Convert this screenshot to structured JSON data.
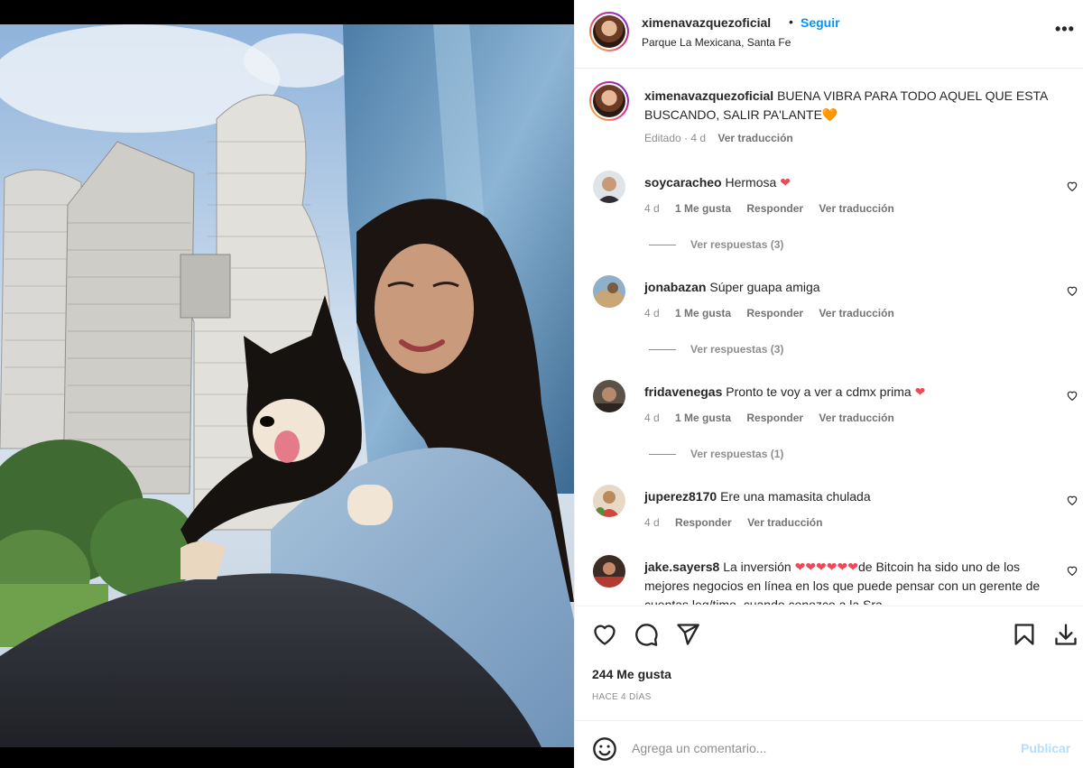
{
  "post": {
    "username": "ximenavazquezoficial",
    "separator": "•",
    "follow_label": "Seguir",
    "location": "Parque La Mexicana, Santa Fe",
    "more_label": "•••"
  },
  "caption": {
    "username": "ximenavazquezoficial",
    "text": "BUENA VIBRA PARA TODO AQUEL QUE ESTA BUSCANDO, SALIR PA'LANTE",
    "emoji": "🧡",
    "edited": "Editado · 4 d",
    "translate": "Ver traducción"
  },
  "comments": [
    {
      "username": "soycaracheo",
      "text": "Hermosa ",
      "emoji": "❤",
      "time": "4 d",
      "likes": "1 Me gusta",
      "reply": "Responder",
      "translate": "Ver traducción",
      "replies": "Ver respuestas (3)"
    },
    {
      "username": "jonabazan",
      "text": "Súper guapa amiga",
      "emoji": "",
      "time": "4 d",
      "likes": "1 Me gusta",
      "reply": "Responder",
      "translate": "Ver traducción",
      "replies": "Ver respuestas (3)"
    },
    {
      "username": "fridavenegas",
      "text": "Pronto te voy a ver a cdmx prima ",
      "emoji": "❤",
      "time": "4 d",
      "likes": "1 Me gusta",
      "reply": "Responder",
      "translate": "Ver traducción",
      "replies": "Ver respuestas (1)"
    },
    {
      "username": "juperez8170",
      "text": "Ere una mamasita chulada",
      "emoji": "",
      "time": "4 d",
      "reply": "Responder",
      "translate": "Ver traducción"
    },
    {
      "username": "jake.sayers8",
      "text_before": "La inversión ",
      "hearts": "❤❤❤❤❤❤",
      "text_after": "de Bitcoin ha sido uno de los mejores negocios en línea en los que puede pensar con un gerente de cuentas leg/timo, cuando conozco a la Sra."
    }
  ],
  "actions": {
    "like_icon": "heart-icon",
    "comment_icon": "comment-icon",
    "share_icon": "share-icon",
    "save_icon": "bookmark-icon",
    "download_icon": "download-icon"
  },
  "likes_text": "244 Me gusta",
  "posted_ago": "HACE 4 DÍAS",
  "add_comment": {
    "placeholder": "Agrega un comentario...",
    "publish_label": "Publicar"
  },
  "colors": {
    "link_blue": "#0095f6",
    "publish_disabled": "#b2dffc",
    "heart_red": "#ed4956",
    "muted": "#8e8e8e"
  }
}
